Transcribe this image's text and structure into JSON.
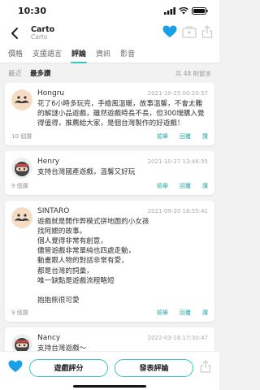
{
  "status": {
    "time": "10:30"
  },
  "header": {
    "title": "Carto",
    "subtitle": "Carto"
  },
  "tabs": [
    {
      "label": "價格",
      "active": false
    },
    {
      "label": "支援語言",
      "active": false
    },
    {
      "label": "評論",
      "active": true
    },
    {
      "label": "資訊",
      "active": false
    },
    {
      "label": "影音",
      "active": false
    }
  ],
  "sort": {
    "recent": "最近",
    "most_liked": "最多讚",
    "count": "共 48 則留言"
  },
  "actions": {
    "report": "檢舉",
    "reply": "回覆",
    "like": "讚"
  },
  "comments": [
    {
      "user": "Hongru",
      "date": "2021-10-25 00:20:57",
      "body": "花了6小時多玩完，手繪風溫暖，故事溫馨，不會太難的解謎小品遊戲，雖然遊戲時長不長，但300塊購入覺得值得，推薦給大家，是個台灣製作的好遊戲！",
      "likes": "10 個讚",
      "avatar": "mustache"
    },
    {
      "user": "Henry",
      "date": "2021-10-27 13:46:55",
      "body": "支持台灣國產遊戲，溫馨又好玩",
      "likes": "9 個讚",
      "avatar": "ninja"
    },
    {
      "user": "SINTARO",
      "date": "2021-09-20 16:55:41",
      "body": "遊戲就是開作弊模式拼地圖的小女孩\n找阿嬤的故事。\n個人覺得非常有創意，\n儘管遊戲非常單純也四處走動，\n動畫跟人物的對話非常有愛，\n都是台灣的詞彙，\n唯一缺點是遊戲流程略短\n\n抱抱熊很可愛",
      "likes": "9 個讚",
      "avatar": "mustache"
    },
    {
      "user": "Nancy",
      "date": "2022-03-18 17:30:47",
      "body": "支持台灣遊戲～",
      "likes": "",
      "avatar": "ninja"
    }
  ],
  "bottom": {
    "rate_label": "遊戲評分",
    "comment_label": "發表評論"
  },
  "colors": {
    "accent": "#35c5c3",
    "heart": "#1aa0e8"
  }
}
